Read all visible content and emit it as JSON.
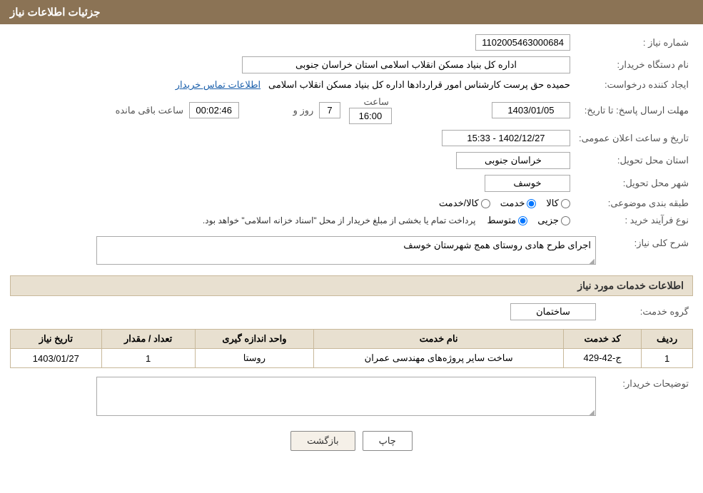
{
  "page": {
    "title": "جزئیات اطلاعات نیاز",
    "header_bg": "#8b7355"
  },
  "fields": {
    "need_number_label": "شماره نیاز :",
    "need_number_value": "1102005463000684",
    "buyer_org_label": "نام دستگاه خریدار:",
    "buyer_org_value": "اداره کل بنیاد مسکن انقلاب اسلامی استان خراسان جنوبی",
    "creator_label": "ایجاد کننده درخواست:",
    "creator_value": "حمیده حق پرست کارشناس امور قراردادها اداره کل بنیاد مسکن انقلاب اسلامی",
    "contact_link": "اطلاعات تماس خریدار",
    "announce_date_label": "تاریخ و ساعت اعلان عمومی:",
    "announce_date_value": "1402/12/27 - 15:33",
    "reply_deadline_label": "مهلت ارسال پاسخ: تا تاریخ:",
    "reply_date_value": "1403/01/05",
    "reply_time_label": "ساعت",
    "reply_time_value": "16:00",
    "reply_days_label": "روز و",
    "reply_days_value": "7",
    "reply_remaining_label": "ساعت باقی مانده",
    "reply_remaining_value": "00:02:46",
    "province_label": "استان محل تحویل:",
    "province_value": "خراسان جنوبی",
    "city_label": "شهر محل تحویل:",
    "city_value": "خوسف",
    "category_label": "طبقه بندی موضوعی:",
    "category_options": [
      {
        "id": "kala",
        "label": "کالا"
      },
      {
        "id": "khadamat",
        "label": "خدمت"
      },
      {
        "id": "kala_khadamat",
        "label": "کالا/خدمت"
      }
    ],
    "category_selected": "khadamat",
    "purchase_type_label": "نوع فرآیند خرید :",
    "purchase_type_options": [
      {
        "id": "jozvi",
        "label": "جزیی"
      },
      {
        "id": "motavaset",
        "label": "متوسط"
      }
    ],
    "purchase_type_selected": "motavaset",
    "purchase_type_note": "پرداخت تمام یا بخشی از مبلغ خریدار از محل \"اسناد خزانه اسلامی\" خواهد بود.",
    "general_desc_label": "شرح کلی نیاز:",
    "general_desc_value": "اجرای طرح هادی روستای همج شهرستان خوسف",
    "services_section_title": "اطلاعات خدمات مورد نیاز",
    "service_group_label": "گروه خدمت:",
    "service_group_value": "ساختمان",
    "table": {
      "headers": [
        "ردیف",
        "کد خدمت",
        "نام خدمت",
        "واحد اندازه گیری",
        "تعداد / مقدار",
        "تاریخ نیاز"
      ],
      "rows": [
        {
          "row_num": "1",
          "service_code": "ج-42-429",
          "service_name": "ساخت سایر پروژه‌های مهندسی عمران",
          "unit": "روستا",
          "quantity": "1",
          "date": "1403/01/27"
        }
      ]
    },
    "buyer_desc_label": "توضیحات خریدار:",
    "buyer_desc_value": "",
    "btn_print": "چاپ",
    "btn_back": "بازگشت"
  }
}
